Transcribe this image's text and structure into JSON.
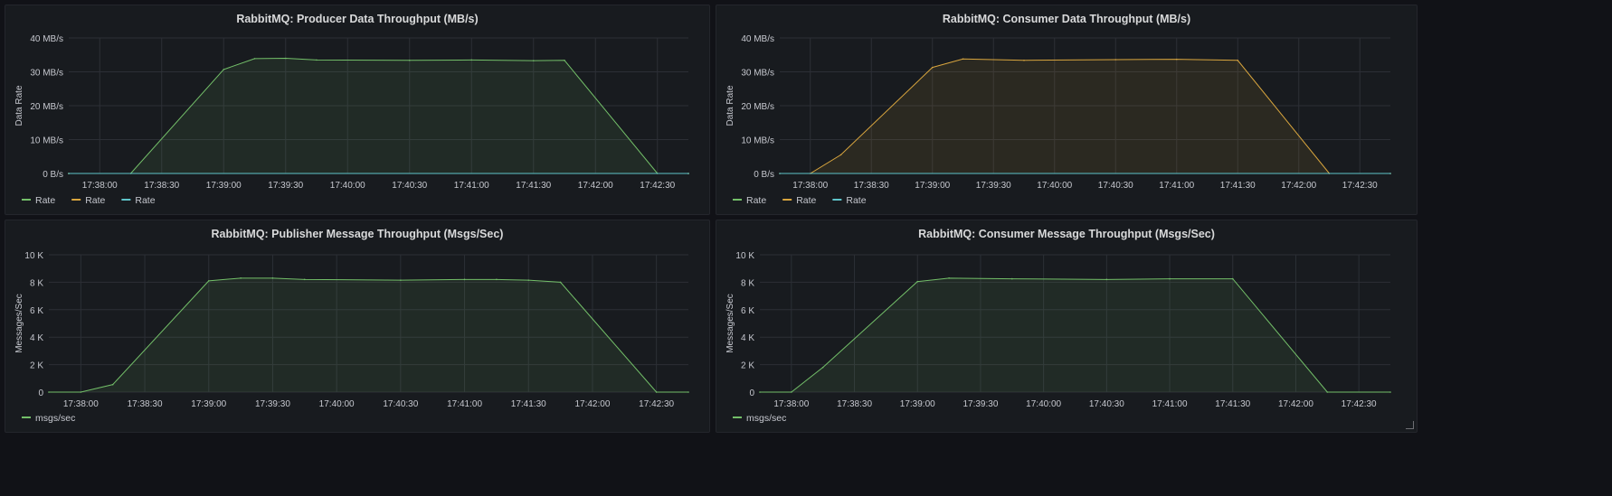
{
  "colors": {
    "green": "#73bf69",
    "yellow": "#d8a53e",
    "teal": "#5ec4c9",
    "grid": "#2c2f36",
    "axis": "#c6c8cf"
  },
  "x_ticks": [
    "17:38:00",
    "17:38:30",
    "17:39:00",
    "17:39:30",
    "17:40:00",
    "17:40:30",
    "17:41:00",
    "17:41:30",
    "17:42:00",
    "17:42:30"
  ],
  "chart_data": [
    {
      "type": "area",
      "title": "RabbitMQ: Producer Data Throughput (MB/s)",
      "ylabel": "Data Rate",
      "y_ticks": [
        "0 B/s",
        "10 MB/s",
        "20 MB/s",
        "30 MB/s",
        "40 MB/s"
      ],
      "ylim": [
        0,
        40
      ],
      "xlim": [
        "17:37:45",
        "17:42:45"
      ],
      "legend": [
        {
          "name": "Rate",
          "color": "#73bf69"
        },
        {
          "name": "Rate",
          "color": "#d8a53e"
        },
        {
          "name": "Rate",
          "color": "#5ec4c9"
        }
      ],
      "series": [
        {
          "name": "Rate",
          "color": "#73bf69",
          "fill": true,
          "x": [
            "17:37:45",
            "17:38:15",
            "17:39:00",
            "17:39:15",
            "17:39:30",
            "17:39:45",
            "17:40:30",
            "17:41:00",
            "17:41:30",
            "17:41:45",
            "17:42:30",
            "17:42:45"
          ],
          "y": [
            0,
            0,
            30.7,
            33.9,
            34.0,
            33.5,
            33.4,
            33.5,
            33.3,
            33.4,
            0,
            0
          ]
        },
        {
          "name": "Rate",
          "color": "#d8a53e",
          "fill": false,
          "x": [
            "17:37:45",
            "17:42:45"
          ],
          "y": [
            0,
            0
          ]
        },
        {
          "name": "Rate",
          "color": "#5ec4c9",
          "fill": false,
          "x": [
            "17:37:45",
            "17:42:45"
          ],
          "y": [
            0,
            0
          ]
        }
      ]
    },
    {
      "type": "area",
      "title": "RabbitMQ: Consumer Data Throughput (MB/s)",
      "ylabel": "Data Rate",
      "y_ticks": [
        "0 B/s",
        "10 MB/s",
        "20 MB/s",
        "30 MB/s",
        "40 MB/s"
      ],
      "ylim": [
        0,
        40
      ],
      "xlim": [
        "17:37:45",
        "17:42:45"
      ],
      "legend": [
        {
          "name": "Rate",
          "color": "#73bf69"
        },
        {
          "name": "Rate",
          "color": "#d8a53e"
        },
        {
          "name": "Rate",
          "color": "#5ec4c9"
        }
      ],
      "series": [
        {
          "name": "Rate",
          "color": "#d8a53e",
          "fill": true,
          "x": [
            "17:37:45",
            "17:38:00",
            "17:38:15",
            "17:39:00",
            "17:39:15",
            "17:39:45",
            "17:40:30",
            "17:41:00",
            "17:41:30",
            "17:42:15",
            "17:42:45"
          ],
          "y": [
            0,
            0,
            5.5,
            31.3,
            33.8,
            33.4,
            33.6,
            33.7,
            33.4,
            0,
            0
          ]
        },
        {
          "name": "Rate",
          "color": "#5ec4c9",
          "fill": false,
          "x": [
            "17:37:45",
            "17:42:45"
          ],
          "y": [
            0,
            0
          ]
        }
      ]
    },
    {
      "type": "area",
      "title": "RabbitMQ: Publisher Message Throughput (Msgs/Sec)",
      "ylabel": "Messages/Sec",
      "y_ticks": [
        "0",
        "2 K",
        "4 K",
        "6 K",
        "8 K",
        "10 K"
      ],
      "ylim": [
        0,
        10000
      ],
      "xlim": [
        "17:37:45",
        "17:42:45"
      ],
      "legend": [
        {
          "name": "msgs/sec",
          "color": "#73bf69"
        }
      ],
      "series": [
        {
          "name": "msgs/sec",
          "color": "#73bf69",
          "fill": true,
          "x": [
            "17:37:45",
            "17:38:00",
            "17:38:15",
            "17:39:00",
            "17:39:15",
            "17:39:30",
            "17:39:45",
            "17:40:30",
            "17:41:00",
            "17:41:15",
            "17:41:30",
            "17:41:45",
            "17:42:30",
            "17:42:45"
          ],
          "y": [
            0,
            0,
            550,
            8100,
            8300,
            8300,
            8200,
            8150,
            8200,
            8200,
            8150,
            8000,
            0,
            0
          ]
        }
      ]
    },
    {
      "type": "area",
      "title": "RabbitMQ: Consumer Message Throughput (Msgs/Sec)",
      "ylabel": "Messages/Sec",
      "y_ticks": [
        "0",
        "2 K",
        "4 K",
        "6 K",
        "8 K",
        "10 K"
      ],
      "ylim": [
        0,
        10000
      ],
      "xlim": [
        "17:37:45",
        "17:42:45"
      ],
      "legend": [
        {
          "name": "msgs/sec",
          "color": "#73bf69"
        }
      ],
      "series": [
        {
          "name": "msgs/sec",
          "color": "#73bf69",
          "fill": true,
          "x": [
            "17:37:45",
            "17:38:00",
            "17:38:15",
            "17:39:00",
            "17:39:15",
            "17:39:45",
            "17:40:30",
            "17:41:00",
            "17:41:30",
            "17:42:15",
            "17:42:45"
          ],
          "y": [
            0,
            0,
            1800,
            8050,
            8300,
            8250,
            8200,
            8250,
            8250,
            0,
            0
          ]
        }
      ]
    }
  ]
}
